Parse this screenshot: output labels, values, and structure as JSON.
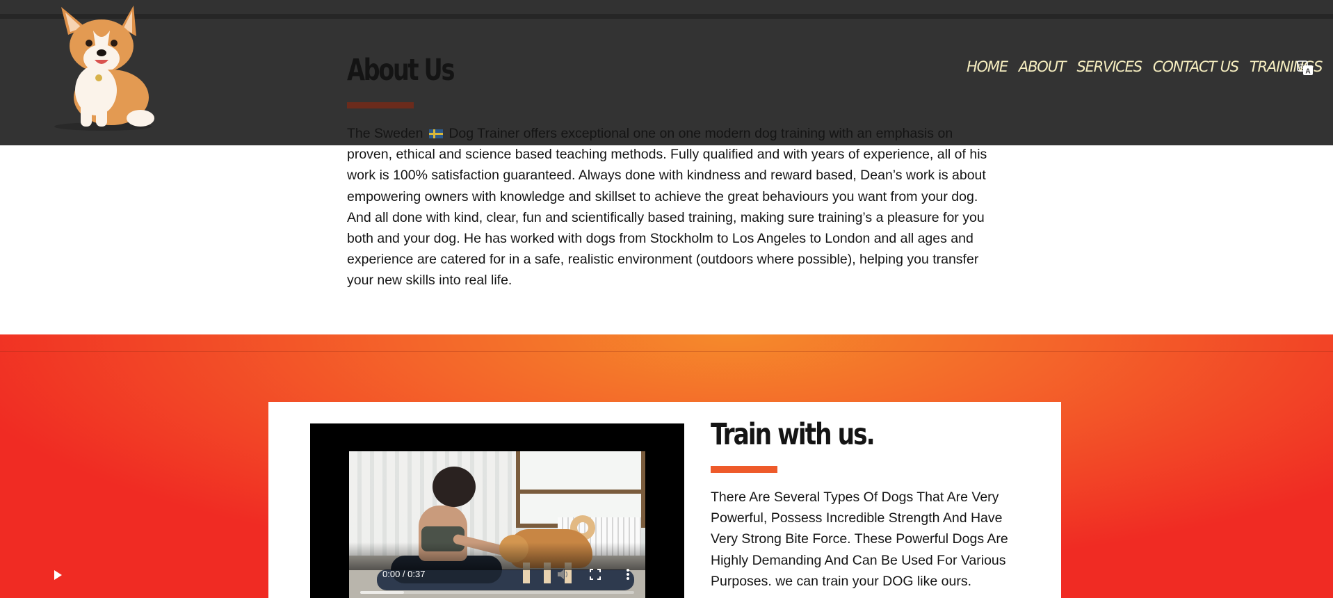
{
  "nav": {
    "items": [
      "HOME",
      "ABOUT",
      "SERVICES",
      "CONTACT US",
      "TRAININGS"
    ]
  },
  "about": {
    "title": "About Us",
    "text_before_flag": "The Sweden ",
    "text_after_flag": " Dog Trainer offers exceptional one on one modern dog training with an emphasis on proven, ethical and science based teaching methods. Fully qualified and with years of experience, all of his work is 100% satisfaction guaranteed. Always done with kindness and reward based, Dean’s work is about empowering owners with knowledge and skillset to achieve the great behaviours you want from your dog. And all done with kind, clear, fun and scientifically based training, making sure training’s a pleasure for you both and your dog. He has worked with dogs from Stockholm to Los Angeles to London and all ages and experience are catered for in a safe, realistic environment (outdoors where possible), helping you transfer your new skills into real life."
  },
  "train": {
    "title": "Train with us.",
    "text": "There Are Several Types Of Dogs That Are Very Powerful, Possess Incredible Strength And Have Very Strong Bite Force. These Powerful Dogs Are Highly Demanding And Can Be Used For Various Purposes. we can train your DOG like ours."
  },
  "video": {
    "time": "0:00 / 0:37",
    "buffered_fraction": 0.16
  },
  "icons": {
    "logo": "corgi-logo",
    "translate": "translate-icon",
    "flag": "sweden-flag"
  },
  "colors": {
    "header_bg": "#333333",
    "nav_text": "#f6eec0",
    "about_accent": "#6b2b1c",
    "train_accent": "#ee5a2a",
    "orange_start": "#f58a2b",
    "orange_end": "#f02b23"
  }
}
